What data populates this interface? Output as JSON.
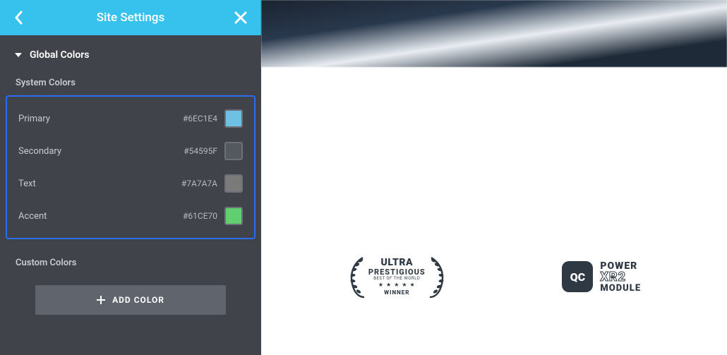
{
  "header": {
    "title": "Site Settings"
  },
  "section": {
    "title": "Global Colors"
  },
  "system_colors": {
    "title": "System Colors",
    "items": [
      {
        "name": "Primary",
        "hex": "#6EC1E4"
      },
      {
        "name": "Secondary",
        "hex": "#54595F"
      },
      {
        "name": "Text",
        "hex": "#7A7A7A"
      },
      {
        "name": "Accent",
        "hex": "#61CE70"
      }
    ]
  },
  "custom_colors": {
    "title": "Custom Colors",
    "add_label": "ADD COLOR"
  },
  "badges": {
    "laurel": {
      "line1": "ULTRA",
      "line2": "PRESTIGIOUS",
      "line3": "BEST OF THE WORLD",
      "stars": "★ ★ ★ ★ ★",
      "line4": "WINNER"
    },
    "qc": {
      "icon": "QC",
      "line1": "POWER",
      "line2": "XR2",
      "line3": "MODULE"
    }
  }
}
